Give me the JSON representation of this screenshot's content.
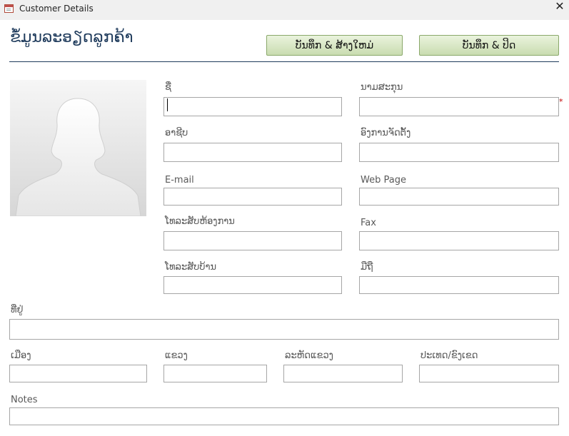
{
  "window": {
    "title": "Customer Details",
    "close_glyph": "✕"
  },
  "form": {
    "title": "ຂໍ້ມູນລະອຽດລູກຄ້າ"
  },
  "buttons": {
    "save_new": "ບັນທຶກ & ສ້າງໃຫມ່",
    "save_close": "ບັນທຶກ & ປິດ"
  },
  "fields": {
    "first_name": {
      "label": "ຊື່",
      "value": ""
    },
    "last_name": {
      "label": "ນາມສະກຸນ",
      "value": "",
      "required_mark": "*"
    },
    "job_title": {
      "label": "ອາຊີບ",
      "value": ""
    },
    "company": {
      "label": "ອົງການຈັດຕັ້ງ",
      "value": ""
    },
    "email": {
      "label": "E-mail",
      "value": ""
    },
    "web_page": {
      "label": "Web Page",
      "value": ""
    },
    "business_phone": {
      "label": "ໂທລະສັບຫ້ອງການ",
      "value": ""
    },
    "fax": {
      "label": "Fax",
      "value": ""
    },
    "home_phone": {
      "label": "ໂທລະສັບບ້ານ",
      "value": ""
    },
    "mobile": {
      "label": "ມືຖື",
      "value": ""
    },
    "address": {
      "label": "ທີ່ຢູ່",
      "value": ""
    },
    "city": {
      "label": "ເມືອງ",
      "value": ""
    },
    "state": {
      "label": "ແຂວງ",
      "value": ""
    },
    "zip": {
      "label": "ລະຫັດແຂວງ",
      "value": ""
    },
    "country": {
      "label": "ປະເທດ/ຂົງເຂດ",
      "value": ""
    },
    "notes": {
      "label": "Notes",
      "value": ""
    }
  },
  "colors": {
    "accent": "#1f3b5c",
    "button_fill": "#d7e6c3",
    "required": "#c00000",
    "field_border": "#a6a6a6"
  },
  "icons": {
    "app": "form-icon",
    "photo": "person-silhouette-icon"
  }
}
